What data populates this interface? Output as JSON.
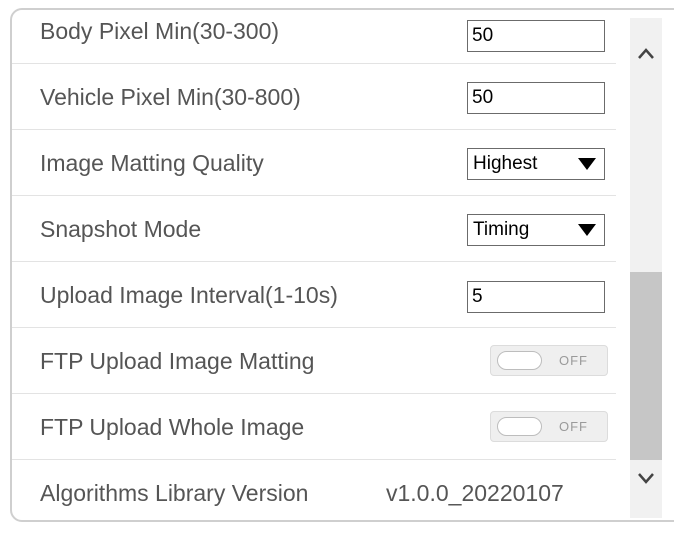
{
  "settings": {
    "body_pixel_min": {
      "label": "Body Pixel Min(30-300)",
      "value": "50"
    },
    "vehicle_pixel_min": {
      "label": "Vehicle Pixel Min(30-800)",
      "value": "50"
    },
    "image_matting_quality": {
      "label": "Image Matting Quality",
      "value": "Highest"
    },
    "snapshot_mode": {
      "label": "Snapshot Mode",
      "value": "Timing"
    },
    "upload_image_interval": {
      "label": "Upload Image Interval(1-10s)",
      "value": "5"
    },
    "ftp_upload_image_matting": {
      "label": "FTP Upload Image Matting",
      "state": "OFF"
    },
    "ftp_upload_whole_image": {
      "label": "FTP Upload Whole Image",
      "state": "OFF"
    },
    "algorithms_library_version": {
      "label": "Algorithms Library Version",
      "value": "v1.0.0_20220107"
    }
  },
  "icons": {
    "scroll_up": "chevron-up-icon",
    "scroll_down": "chevron-down-icon"
  },
  "colors": {
    "label_text": "#555555",
    "border": "#cfcfcf",
    "scroll_thumb": "#c6c6c6"
  }
}
